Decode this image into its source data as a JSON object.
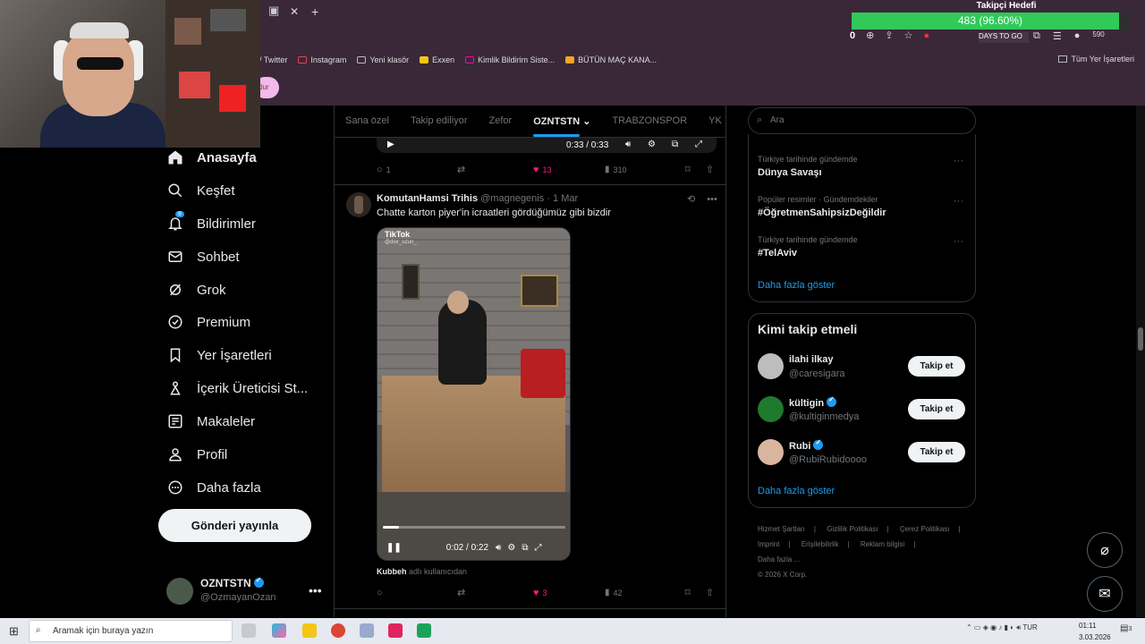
{
  "goal_widget": {
    "title": "Takipçi Hedefi",
    "text": "483 (96.60%)",
    "fraction": 0.966
  },
  "browser": {
    "tab_close": "✕",
    "tab_new": "+",
    "counter": "0",
    "days_to_go": "DAYS TO GO",
    "badge_count": "590",
    "pill_text": "dur",
    "bookmarks": [
      {
        "label": "/ Twitter"
      },
      {
        "label": "Instagram"
      },
      {
        "label": "Yeni klasör"
      },
      {
        "label": "Exxen"
      },
      {
        "label": "Kimlik Bildirim Siste..."
      },
      {
        "label": "BÜTÜN MAÇ KANA..."
      }
    ],
    "bookmarks_all": "Tüm Yer İşaretleri"
  },
  "nav": {
    "items": [
      {
        "label": "Anasayfa",
        "icon": "home-icon"
      },
      {
        "label": "Keşfet",
        "icon": "search-icon"
      },
      {
        "label": "Bildirimler",
        "icon": "bell-icon",
        "badge": "8"
      },
      {
        "label": "Sohbet",
        "icon": "mail-icon"
      },
      {
        "label": "Grok",
        "icon": "grok-icon"
      },
      {
        "label": "Premium",
        "icon": "verified-icon"
      },
      {
        "label": "Yer İşaretleri",
        "icon": "bookmark-icon"
      },
      {
        "label": "İçerik Üreticisi St...",
        "icon": "creator-icon"
      },
      {
        "label": "Makaleler",
        "icon": "article-icon"
      },
      {
        "label": "Profil",
        "icon": "profile-icon"
      },
      {
        "label": "Daha fazla",
        "icon": "more-icon"
      }
    ],
    "post_button": "Gönderi yayınla",
    "account": {
      "name": "OZNTSTN",
      "handle": "@OzmayanOzan",
      "more": "•••"
    }
  },
  "feed": {
    "tabs": [
      {
        "label": "Sana özel"
      },
      {
        "label": "Takip ediliyor"
      },
      {
        "label": "Zefor"
      },
      {
        "label": "OZNTSTN ⌄"
      },
      {
        "label": "TRABZONSPOR"
      },
      {
        "label": "YK"
      }
    ],
    "prev_video_time": "0:33 / 0:33",
    "prev_actions": {
      "replies": "1",
      "likes": "13",
      "views": "310"
    },
    "tweet": {
      "name": "KomutanHamsi Trihis",
      "handle": "@magnegenis",
      "date": "· 1 Mar",
      "text": "Chatte karton piyer'in icraatleri gördüğümüz gibi bizdir",
      "tiktok_label": "TikTok",
      "tiktok_user": "@dior_uzun_",
      "video_time": "0:02 / 0:22",
      "video_progress": 0.09,
      "attrib_name": "Kubbeh",
      "attrib_text": "adlı kullanıcıdan",
      "actions": {
        "replies": "",
        "likes": "3",
        "views": "42"
      }
    }
  },
  "sidebar": {
    "search_placeholder": "Ara",
    "trends": [
      {
        "context": "Türkiye tarihinde gündemde",
        "name": "Dünya Savaşı"
      },
      {
        "context": "Popüler resimler · Gündemdekiler",
        "name": "#ÖğretmenSahipsizDeğildir"
      },
      {
        "context": "Türkiye tarihinde gündemde",
        "name": "#TelAviv"
      }
    ],
    "trends_more": "Daha fazla göster",
    "who_to_follow_title": "Kimi takip etmeli",
    "follow_suggestions": [
      {
        "name": "ilahi ilkay",
        "handle": "@caresigara",
        "verified": false,
        "button": "Takip et"
      },
      {
        "name": "kültigin",
        "handle": "@kultiginmedya",
        "verified": true,
        "button": "Takip et"
      },
      {
        "name": "Rubi",
        "handle": "@RubiRubidoooo",
        "verified": true,
        "button": "Takip et"
      }
    ],
    "follow_more": "Daha fazla göster",
    "footer": [
      "Hizmet Şartları",
      "|",
      "Gizlilik Politikası",
      "|",
      "Çerez Politikası",
      "|",
      "Imprint",
      "|",
      "Erişilebilirlik",
      "|",
      "Reklam bilgisi",
      "|",
      "Daha fazla ...",
      "© 2026 X Corp."
    ]
  },
  "taskbar": {
    "search_placeholder": "Aramak için buraya yazın",
    "lang": "TUR",
    "time": "01:11",
    "date": "3.03.2026",
    "notif_count": "3"
  }
}
